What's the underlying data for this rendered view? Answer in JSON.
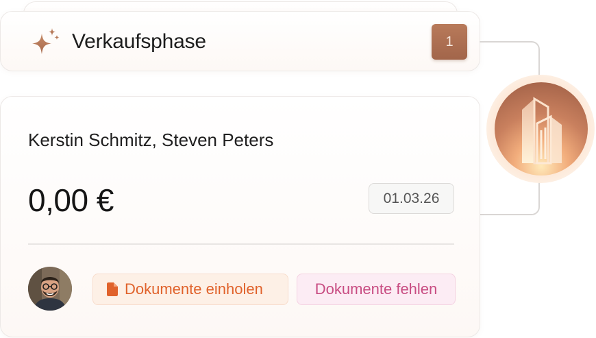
{
  "stage": {
    "label": "Verkaufsphase",
    "count": "1",
    "icon": "sparkle-icon"
  },
  "deal": {
    "names": "Kerstin Schmitz, Steven Peters",
    "amount": "0,00 €",
    "date": "01.03.26",
    "avatar_icon": "avatar-photo",
    "tags": [
      {
        "label": "Dokumente einholen",
        "icon": "document-icon",
        "color": "#e0622b",
        "background": "#fdf0e6"
      },
      {
        "label": "Dokumente fehlen",
        "color": "#c84c82",
        "background": "#fcecf4"
      }
    ]
  },
  "building_badge": {
    "icon": "building-icon"
  },
  "colors": {
    "accent_brown": "#a2654a",
    "text_dark": "#1d1d1d"
  }
}
